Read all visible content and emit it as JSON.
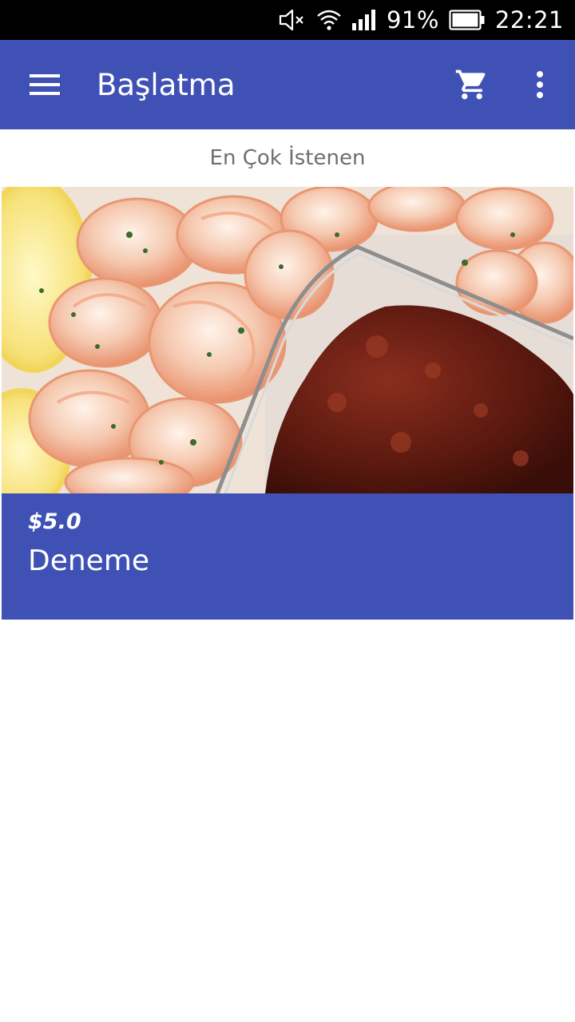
{
  "status_bar": {
    "battery_percent": "91%",
    "time": "22:21",
    "icons": [
      "mute-icon",
      "wifi-icon",
      "signal-icon",
      "battery-icon"
    ]
  },
  "app_bar": {
    "title": "Başlatma",
    "background_color": "#3F51B5",
    "icons": [
      "hamburger-menu-icon",
      "shopping-cart-icon",
      "more-vertical-icon"
    ]
  },
  "section": {
    "header": "En Çok İstenen"
  },
  "products": [
    {
      "price": "$5.0",
      "name": "Deneme",
      "image": "shrimp-cocktail-photo"
    }
  ]
}
